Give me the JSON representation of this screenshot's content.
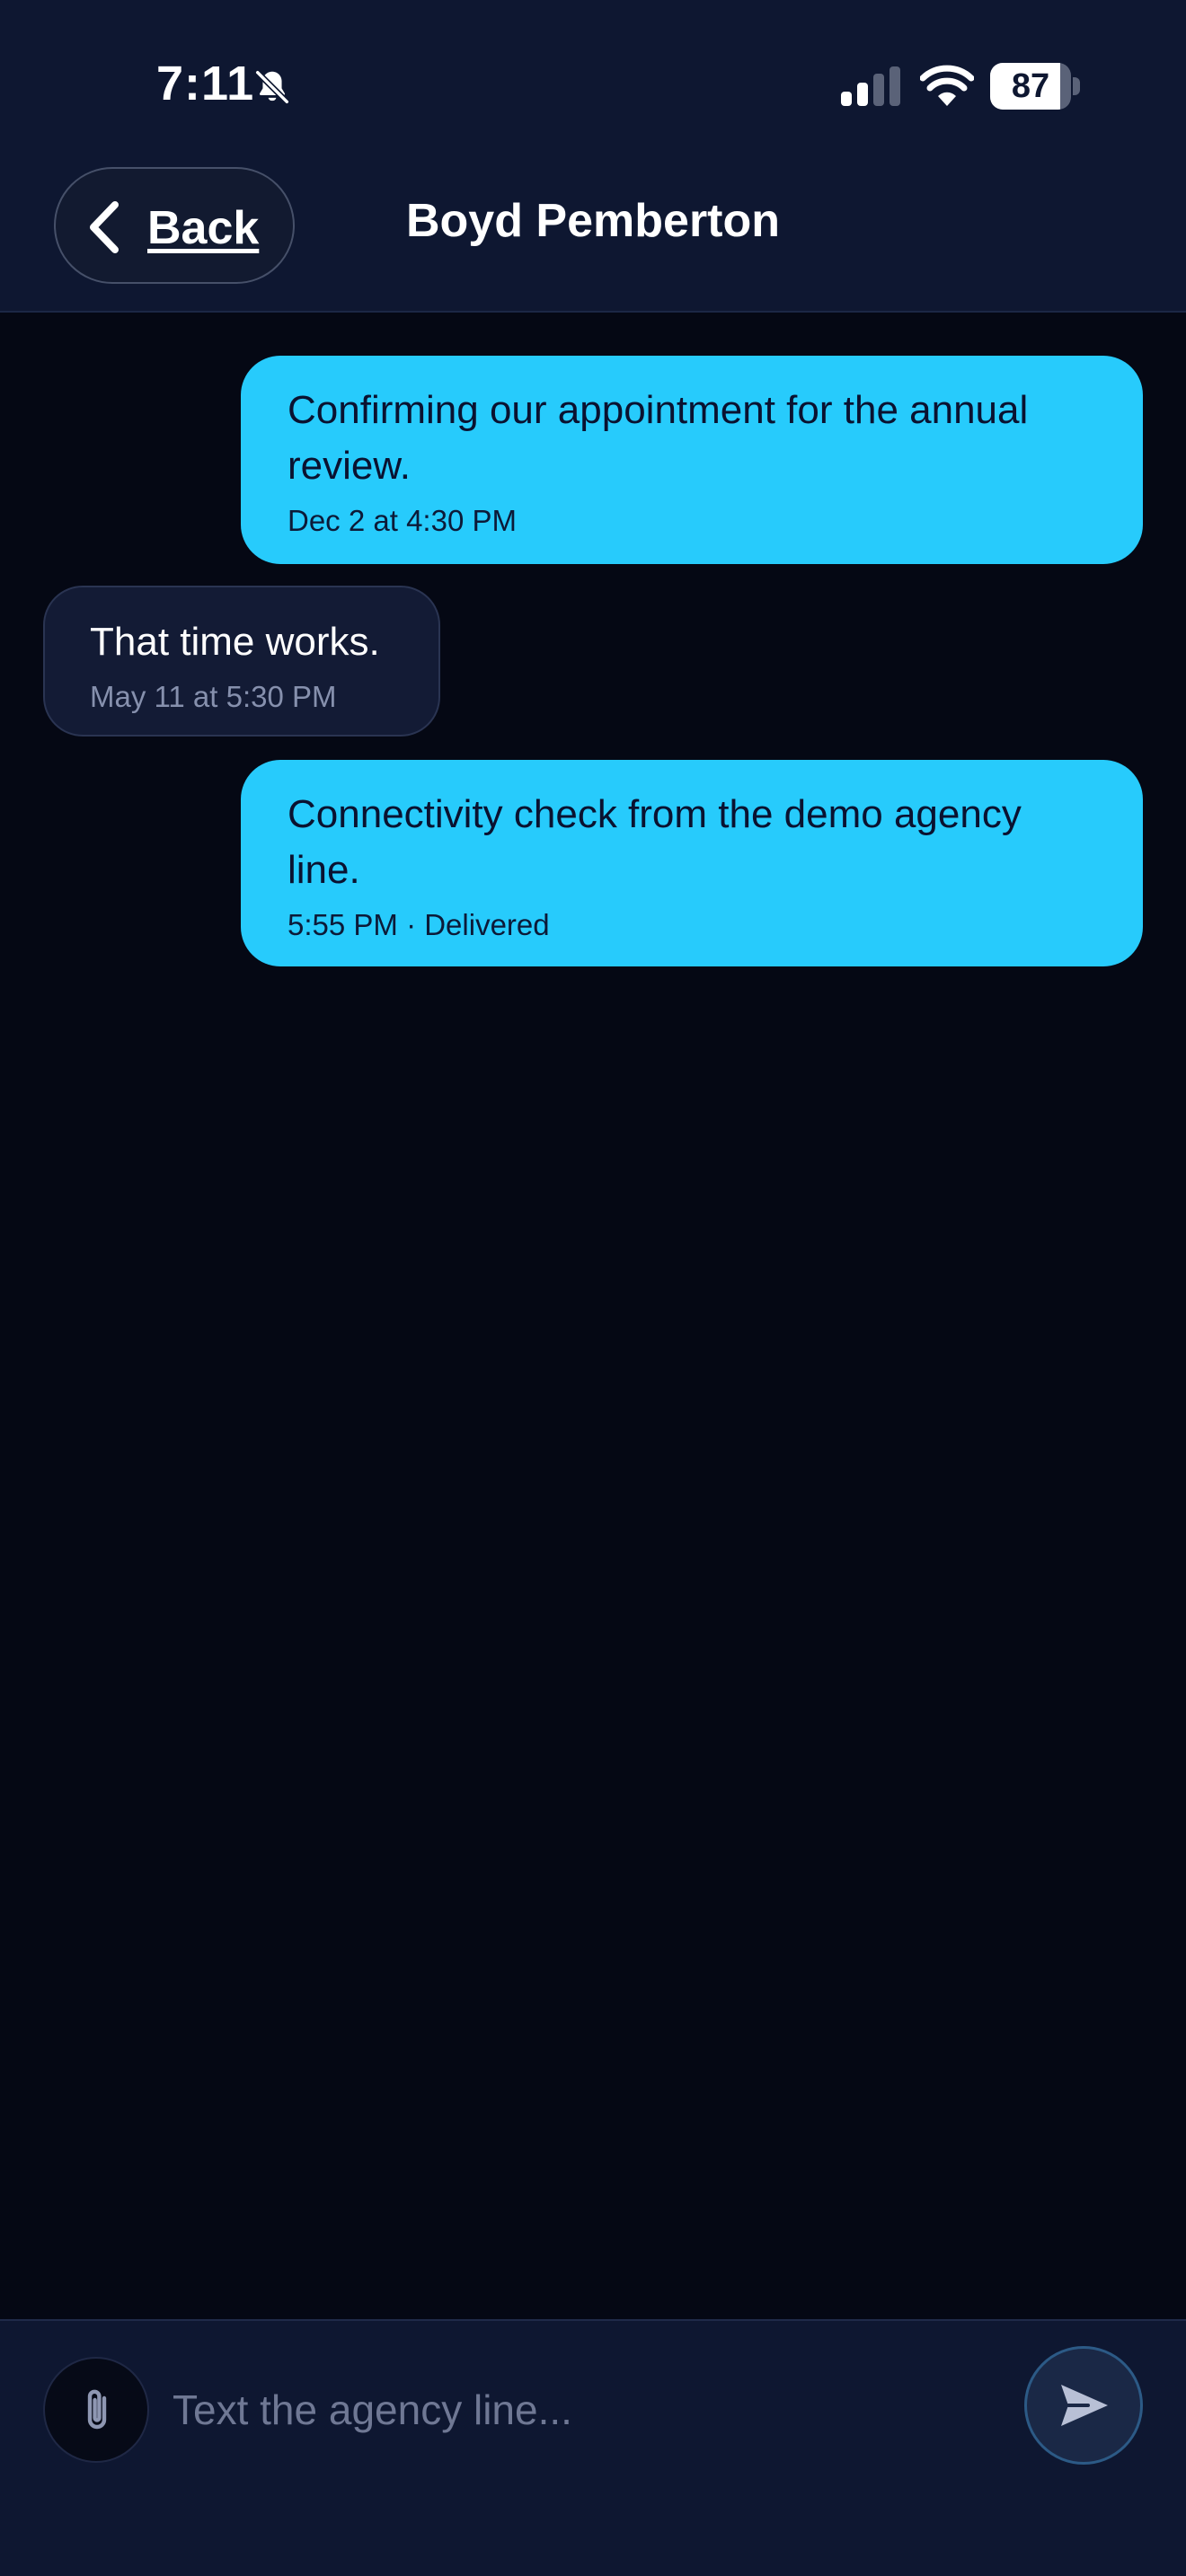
{
  "status": {
    "time": "7:11",
    "battery": "87",
    "battery_level": 0.87,
    "icons": [
      "bell-slash-icon",
      "signal-bars-icon",
      "wifi-icon",
      "battery-icon"
    ]
  },
  "nav": {
    "back_label": "Back",
    "contact_name": "Boyd Pemberton"
  },
  "messages": [
    {
      "direction": "outgoing",
      "text": "Confirming our appointment for the annual review.",
      "meta": "Dec 2 at 4:30 PM"
    },
    {
      "direction": "incoming",
      "text": "That time works.",
      "meta": "May 11 at 5:30 PM"
    },
    {
      "direction": "outgoing",
      "text": "Connectivity check from the demo agency line.",
      "meta": "5:55 PM · Delivered"
    }
  ],
  "composer": {
    "placeholder": "Text the agency line...",
    "value": "",
    "attach_icon": "paperclip-icon",
    "send_icon": "send-icon"
  },
  "colors": {
    "background": "#050814",
    "chrome": "#0e1731",
    "outgoing_bubble": "#27cbfc",
    "incoming_bubble": "#131b35"
  }
}
